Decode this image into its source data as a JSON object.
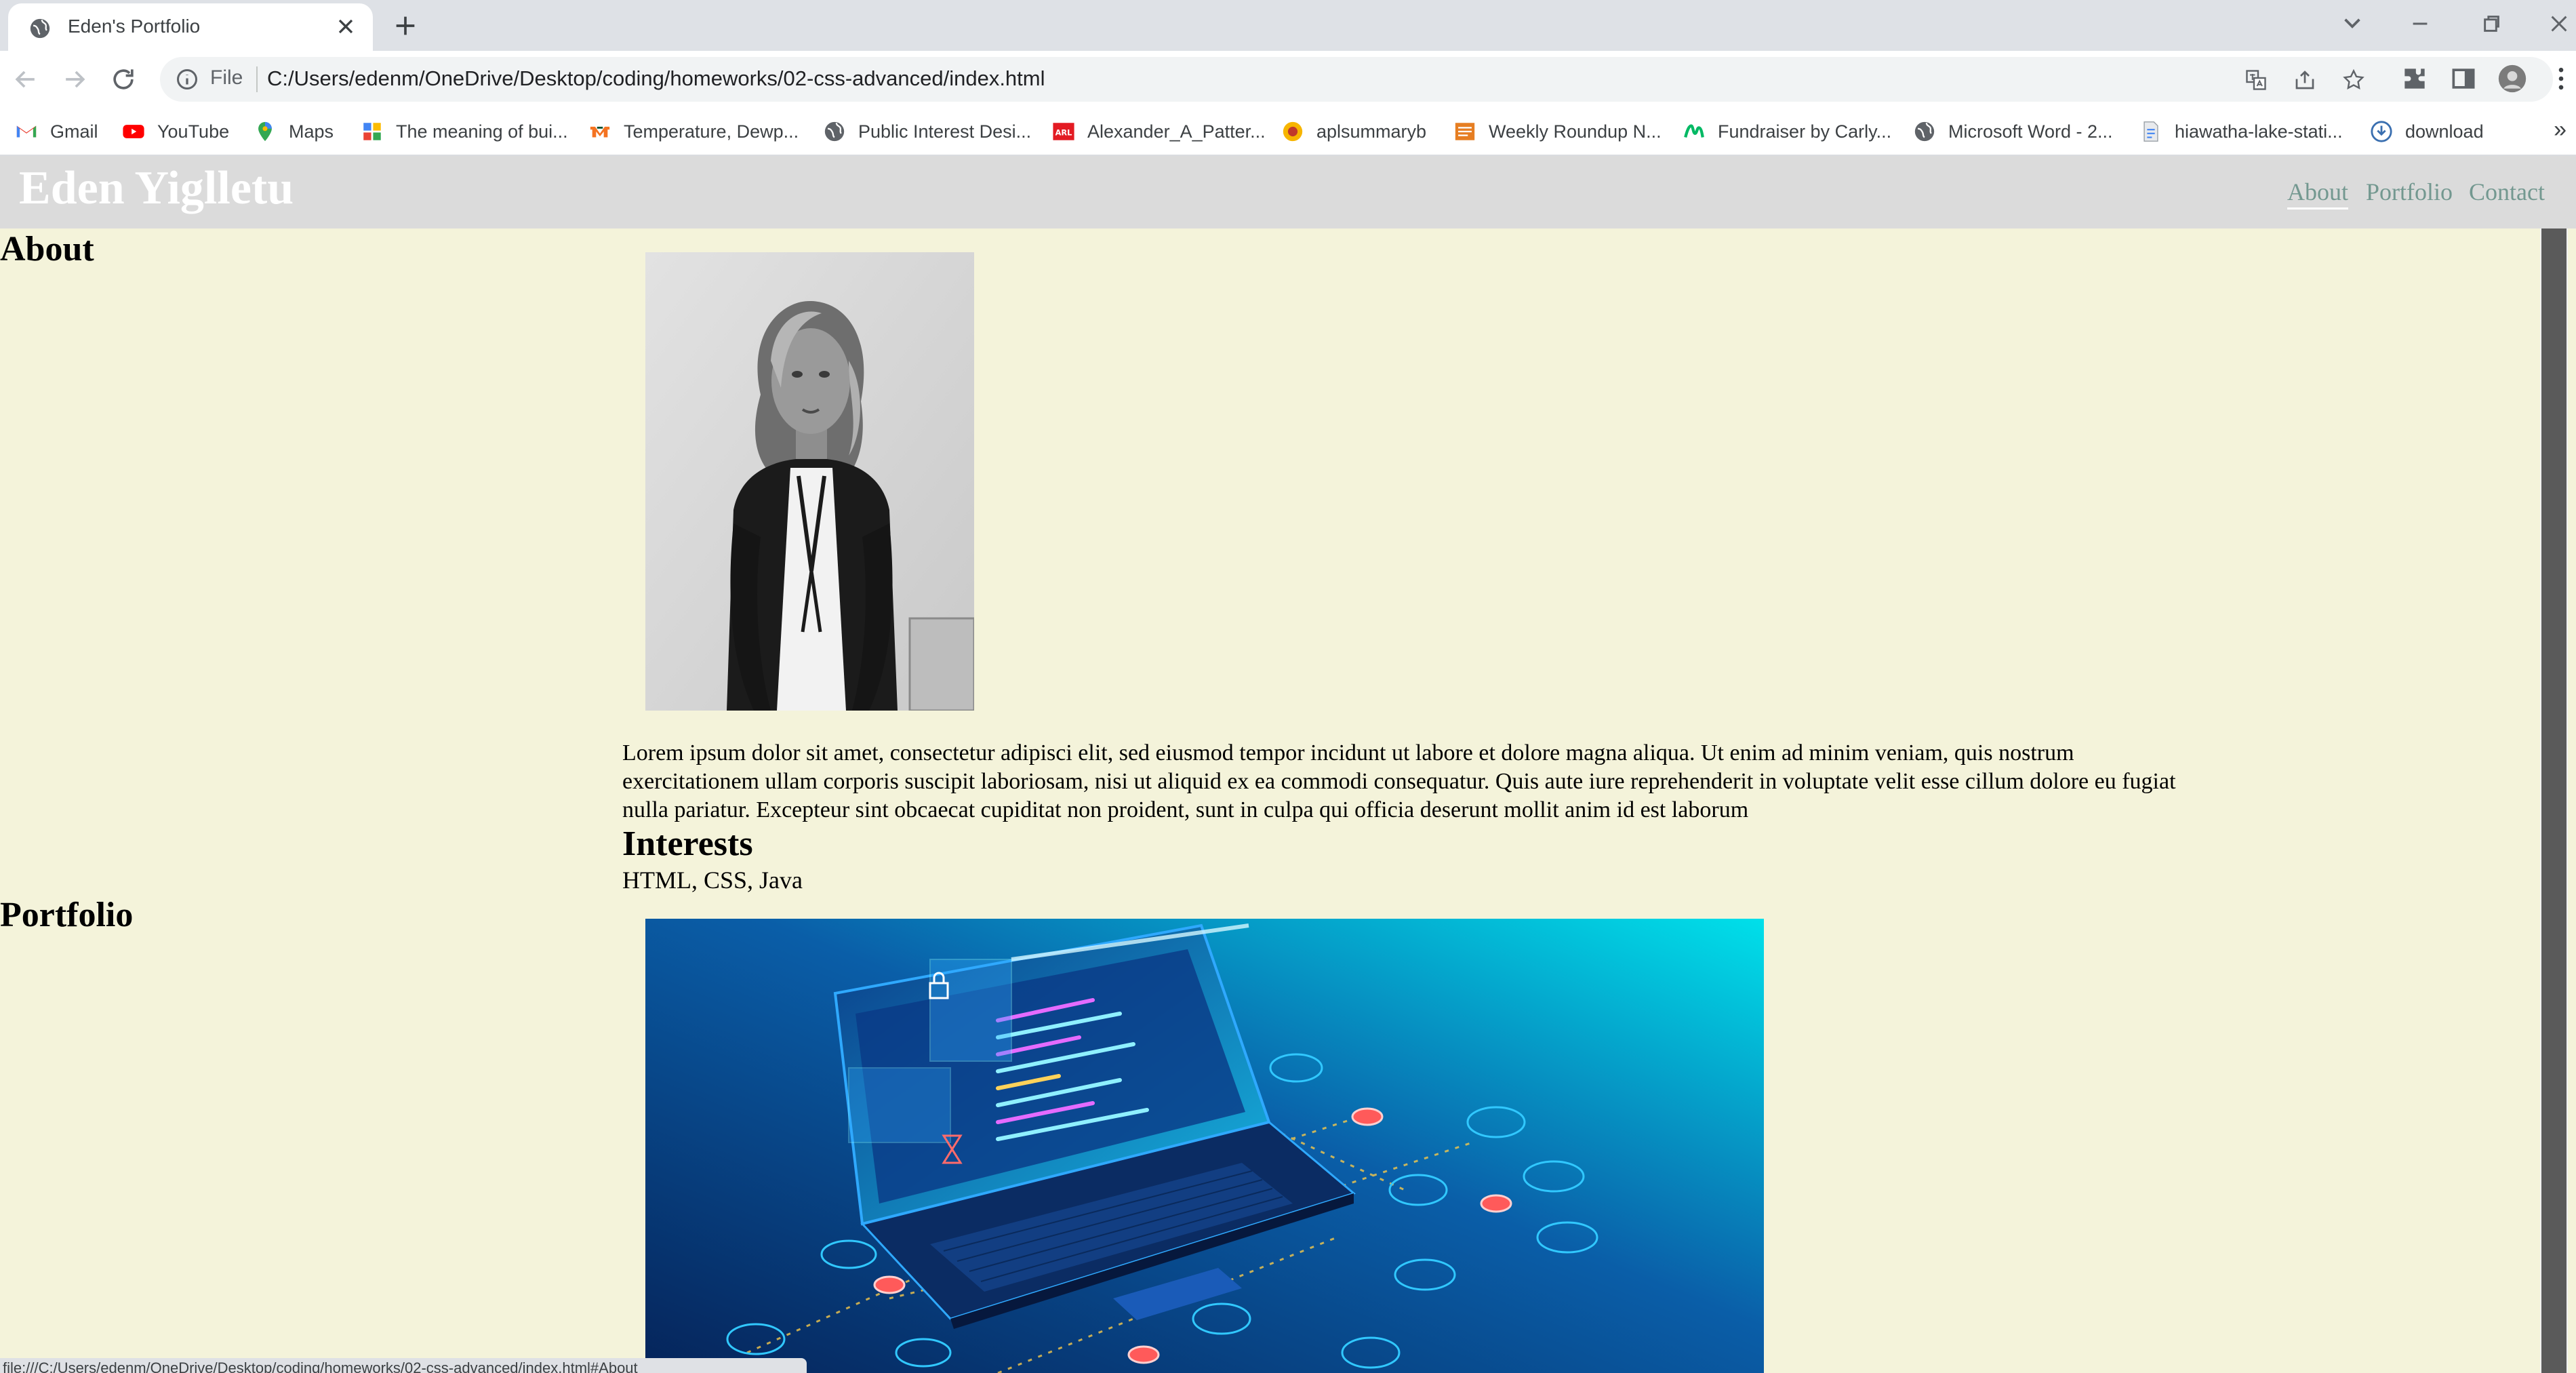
{
  "browser": {
    "tab_title": "Eden's Portfolio",
    "scheme_label": "File",
    "url": "C:/Users/edenm/OneDrive/Desktop/coding/homeworks/02-css-advanced/index.html",
    "status_url": "file:///C:/Users/edenm/OneDrive/Desktop/coding/homeworks/02-css-advanced/index.html#About"
  },
  "bookmarks": [
    {
      "label": "Gmail",
      "icon": "gmail-icon"
    },
    {
      "label": "YouTube",
      "icon": "youtube-icon"
    },
    {
      "label": "Maps",
      "icon": "maps-icon"
    },
    {
      "label": "The meaning of bui...",
      "icon": "page-icon"
    },
    {
      "label": "Temperature, Dewp...",
      "icon": "um-icon"
    },
    {
      "label": "Public Interest Desi...",
      "icon": "globe-icon"
    },
    {
      "label": "Alexander_A_Patter...",
      "icon": "arl-icon"
    },
    {
      "label": "aplsummaryb",
      "icon": "badge-icon"
    },
    {
      "label": "Weekly Roundup N...",
      "icon": "newsletter-icon"
    },
    {
      "label": "Fundraiser by Carly...",
      "icon": "gofundme-icon"
    },
    {
      "label": "Microsoft Word - 2...",
      "icon": "globe-icon"
    },
    {
      "label": "hiawatha-lake-stati...",
      "icon": "doc-icon"
    },
    {
      "label": "download",
      "icon": "download-icon"
    }
  ],
  "site": {
    "name": "Eden Yiglletu",
    "nav": [
      "About",
      "Portfolio",
      "Contact"
    ]
  },
  "about": {
    "heading": "About",
    "text": "Lorem ipsum dolor sit amet, consectetur adipisci elit, sed eiusmod tempor incidunt ut labore et dolore magna aliqua. Ut enim ad minim veniam, quis nostrum exercitationem ullam corporis suscipit laboriosam, nisi ut aliquid ex ea commodi consequatur. Quis aute iure reprehenderit in voluptate velit esse cillum dolore eu fugiat nulla pariatur. Excepteur sint obcaecat cupiditat non proident, sunt in culpa qui officia deserunt mollit anim id est laborum",
    "interests_heading": "Interests",
    "interests": "HTML, CSS, Java"
  },
  "portfolio": {
    "heading": "Portfolio"
  }
}
